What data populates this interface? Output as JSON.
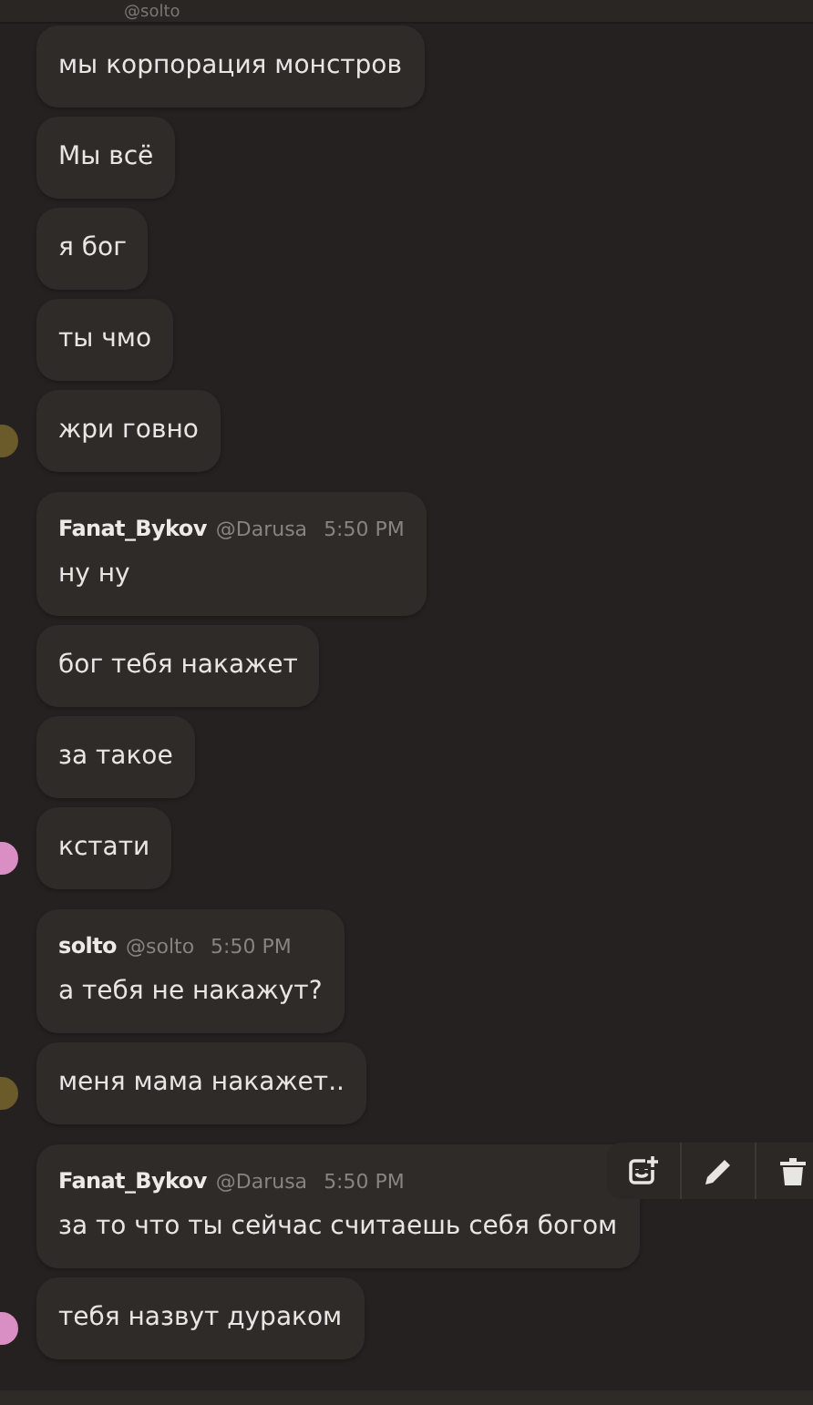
{
  "header": {
    "handle": "@solto"
  },
  "messages": [
    {
      "text": "мы корпорация монстров"
    },
    {
      "text": "Мы всё"
    },
    {
      "text": "я бог"
    },
    {
      "text": "ты чмо"
    },
    {
      "text": "жри говно",
      "color": "#6b5a2a"
    },
    {
      "author": "Fanat_Bykov",
      "handle": "@Darusa",
      "time": "5:50 PM",
      "text": "ну ну"
    },
    {
      "text": "бог тебя накажет"
    },
    {
      "text": "за такое"
    },
    {
      "text": "кстати",
      "color": "#d98fc4"
    },
    {
      "author": "solto",
      "handle": "@solto",
      "time": "5:50 PM",
      "text": "а тебя не накажут?"
    },
    {
      "text": "меня мама накажет..",
      "color": "#6b5a2a"
    },
    {
      "author": "Fanat_Bykov",
      "handle": "@Darusa",
      "time": "5:50 PM",
      "text": "за то что ты сейчас считаешь себя богом",
      "hovered": true
    },
    {
      "text": "тебя назвут дураком",
      "color": "#d98fc4"
    }
  ]
}
